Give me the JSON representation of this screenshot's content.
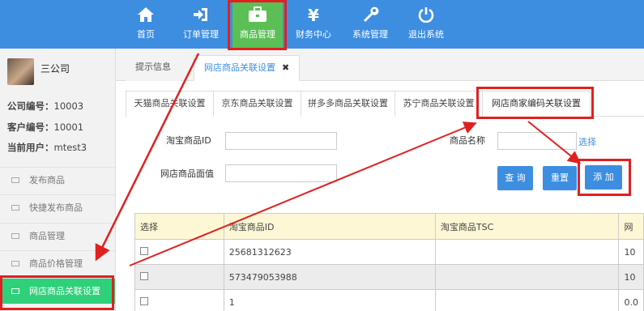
{
  "topnav": {
    "items": [
      {
        "label": "首页",
        "icon": "home-icon"
      },
      {
        "label": "订单管理",
        "icon": "sign-in-icon"
      },
      {
        "label": "商品管理",
        "icon": "briefcase-icon"
      },
      {
        "label": "财务中心",
        "icon": "yen-icon"
      },
      {
        "label": "系统管理",
        "icon": "wrench-icon"
      },
      {
        "label": "退出系统",
        "icon": "power-icon"
      }
    ],
    "active_color": "#5bbf55",
    "bar_color": "#3d8ee0"
  },
  "sidebar": {
    "company": "三公司",
    "company_no_label": "公司编号：",
    "company_no": "10003",
    "customer_no_label": "客户编号：",
    "customer_no": "10001",
    "user_label": "当前用户：",
    "user": "mtest3",
    "items": [
      {
        "label": "发布商品"
      },
      {
        "label": "快捷发布商品"
      },
      {
        "label": "商品管理"
      },
      {
        "label": "商品价格管理"
      },
      {
        "label": "网店商品关联设置"
      }
    ],
    "active_color": "#2fd07a"
  },
  "page_tabs": [
    {
      "label": "提示信息"
    },
    {
      "label": "网店商品关联设置",
      "close": "✖"
    }
  ],
  "sub_tabs": [
    {
      "label": "天猫商品关联设置"
    },
    {
      "label": "京东商品关联设置"
    },
    {
      "label": "拼多多商品关联设置"
    },
    {
      "label": "苏宁商品关联设置"
    },
    {
      "label": "网店商家编码关联设置"
    }
  ],
  "form": {
    "taobao_id_label": "淘宝商品ID",
    "product_name_label": "商品名称",
    "select_link": "选择",
    "face_value_label": "网店商品面值",
    "query_button": "查 询",
    "reset_button": "重置",
    "add_button": "添 加"
  },
  "table": {
    "headers": [
      "选择",
      "淘宝商品ID",
      "淘宝商品TSC",
      "网"
    ],
    "rows": [
      {
        "id": "25681312623",
        "tsc": "",
        "extra": "10"
      },
      {
        "id": "573479053988",
        "tsc": "",
        "extra": "10"
      },
      {
        "id": "1",
        "tsc": "",
        "extra": "0.0"
      }
    ]
  },
  "annotation_color": "#e02020"
}
